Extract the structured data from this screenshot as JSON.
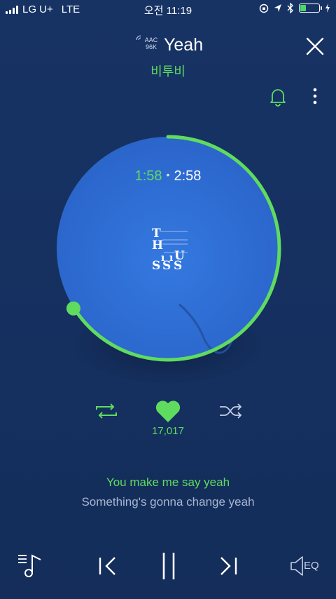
{
  "status_bar": {
    "carrier": "LG U+",
    "network": "LTE",
    "time": "오전 11:19",
    "battery_level": 0.3
  },
  "header": {
    "quality_codec": "AAC",
    "quality_bitrate": "96K",
    "title": "Yeah",
    "artist": "비투비"
  },
  "player": {
    "current_time": "1:58",
    "total_time": "2:58",
    "progress": 0.66,
    "like_count": "17,017"
  },
  "lyrics": {
    "current_line": "You make me say yeah",
    "next_line": "Something's gonna change yeah"
  },
  "controls": {
    "eq_label": "EQ"
  },
  "colors": {
    "accent": "#5fdc5f",
    "background": "#163263",
    "disc": "#2f6fd6"
  },
  "icons": [
    "close-icon",
    "bell-icon",
    "more-icon",
    "repeat-icon",
    "heart-icon",
    "shuffle-icon",
    "playlist-icon",
    "previous-icon",
    "pause-icon",
    "next-icon",
    "eq-icon"
  ]
}
